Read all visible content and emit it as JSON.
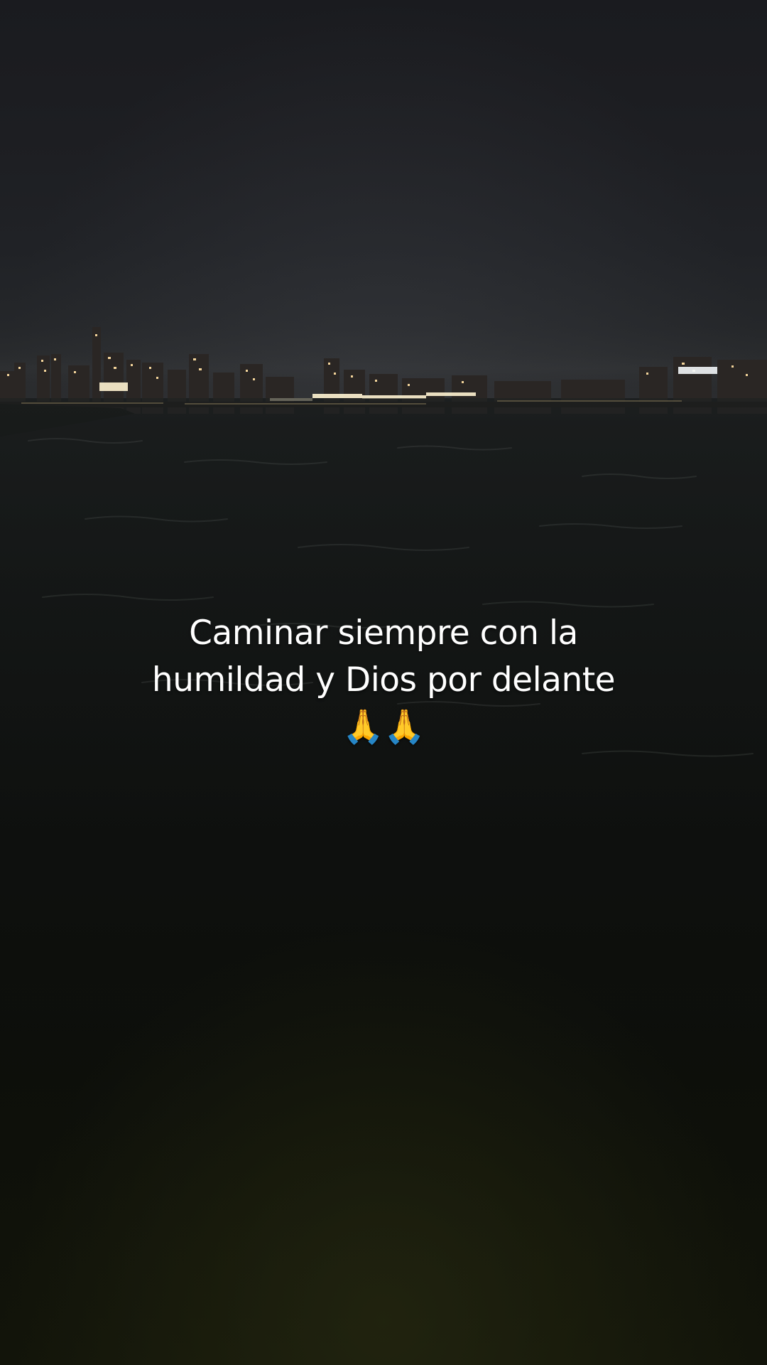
{
  "overlay_text": {
    "line1": "Caminar siempre con la",
    "line2": "humildad y Dios por delante",
    "line3": "🙏🙏"
  },
  "scene": {
    "description_colors": {
      "sky": "#1f2024",
      "water": "#121414",
      "city_lights": "#f5d9a0"
    }
  }
}
